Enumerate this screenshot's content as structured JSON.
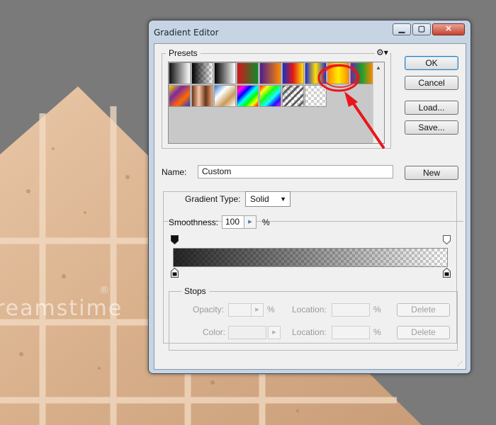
{
  "dialog": {
    "title": "Gradient Editor",
    "window_buttons": {
      "minimize": "minimize-icon",
      "maximize": "maximize-icon",
      "close": "close-icon"
    }
  },
  "presets": {
    "label": "Presets",
    "menu_icon": "gear-icon",
    "swatches_row1": [
      "foreground-to-background",
      "foreground-to-transparent",
      "black-white",
      "red-green",
      "violet-orange",
      "blue-red-yellow",
      "blue-yellow-blue",
      "orange-yellow-orange",
      "violet-green-orange"
    ],
    "swatches_row2": [
      "yellow-violet-orange-blue",
      "copper",
      "chrome",
      "spectrum",
      "transparent-rainbow",
      "transparent-stripes",
      "transparent-checker"
    ],
    "highlight": "orange-yellow-orange"
  },
  "buttons": {
    "ok": "OK",
    "cancel": "Cancel",
    "load": "Load...",
    "save": "Save...",
    "new": "New"
  },
  "name": {
    "label": "Name:",
    "value": "Custom"
  },
  "gradient_type": {
    "label": "Gradient Type:",
    "value": "Solid"
  },
  "smoothness": {
    "label": "Smoothness:",
    "value": "100",
    "unit": "%"
  },
  "stops": {
    "label": "Stops",
    "opacity": {
      "label": "Opacity:",
      "value": "",
      "unit": "%"
    },
    "opacity_location": {
      "label": "Location:",
      "value": "",
      "unit": "%"
    },
    "opacity_delete": "Delete",
    "color": {
      "label": "Color:"
    },
    "color_location": {
      "label": "Location:",
      "value": "",
      "unit": "%"
    },
    "color_delete": "Delete"
  },
  "background": {
    "watermark": "reamstime",
    "watermark_mark": "®"
  },
  "colors": {
    "annotation": "#e8161b",
    "window_frame": "#c6d4e4",
    "close_button": "#c7432f"
  }
}
